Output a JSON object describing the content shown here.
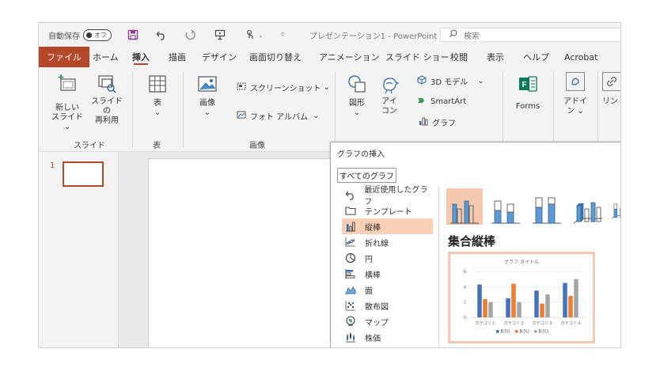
{
  "titlebar": {
    "autosave_label": "自動保存",
    "autosave_state": "オフ",
    "doc_title": "プレゼンテーション1 - PowerPoint",
    "search_placeholder": "検索"
  },
  "tabs": [
    {
      "label": "ファイル"
    },
    {
      "label": "ホーム"
    },
    {
      "label": "挿入"
    },
    {
      "label": "描画"
    },
    {
      "label": "デザイン"
    },
    {
      "label": "画面切り替え"
    },
    {
      "label": "アニメーション"
    },
    {
      "label": "スライド ショー"
    },
    {
      "label": "校閲"
    },
    {
      "label": "表示"
    },
    {
      "label": "ヘルプ"
    },
    {
      "label": "Acrobat"
    }
  ],
  "ribbon": {
    "new_slide_line1": "新しい",
    "new_slide_line2": "スライド",
    "reuse_line1": "スライドの",
    "reuse_line2": "再利用",
    "group_slides": "スライド",
    "table": "表",
    "group_table": "表",
    "images": "画像",
    "screenshot": "スクリーンショット",
    "photo_album": "フォト アルバム",
    "group_images": "画像",
    "shapes": "図形",
    "icons_line1": "アイ",
    "icons_line2": "コン",
    "model3d": "3D モデル",
    "smartart": "SmartArt",
    "chart": "グラフ",
    "forms": "Forms",
    "addins_line1": "アドイ",
    "addins_line2": "ン",
    "link": "リン"
  },
  "slides": [
    {
      "number": "1"
    }
  ],
  "dialog": {
    "title": "グラフの挿入",
    "tab": "すべてのグラフ",
    "types": [
      {
        "label": "最近使用したグラフ",
        "icon": "undo-icon"
      },
      {
        "label": "テンプレート",
        "icon": "folder-icon"
      },
      {
        "label": "縦棒",
        "icon": "column-chart-icon",
        "selected": true
      },
      {
        "label": "折れ線",
        "icon": "line-chart-icon"
      },
      {
        "label": "円",
        "icon": "pie-chart-icon"
      },
      {
        "label": "横棒",
        "icon": "bar-chart-icon"
      },
      {
        "label": "面",
        "icon": "area-chart-icon"
      },
      {
        "label": "散布図",
        "icon": "scatter-chart-icon"
      },
      {
        "label": "マップ",
        "icon": "map-chart-icon"
      },
      {
        "label": "株価",
        "icon": "stock-chart-icon"
      }
    ],
    "selected_subtype": "集合縦棒"
  },
  "chart_data": {
    "type": "bar",
    "title": "グラフ タイトル",
    "categories": [
      "カテゴリ 1",
      "カテゴリ 2",
      "カテゴリ 3",
      "カテゴリ 4"
    ],
    "series": [
      {
        "name": "系列1",
        "values": [
          4.3,
          2.5,
          3.5,
          4.5
        ],
        "color": "#4472c4"
      },
      {
        "name": "系列2",
        "values": [
          2.4,
          4.4,
          1.8,
          2.8
        ],
        "color": "#ed7d31"
      },
      {
        "name": "系列3",
        "values": [
          2.0,
          2.0,
          3.0,
          5.0
        ],
        "color": "#a5a5a5"
      }
    ],
    "yticks": [
      "0",
      "2",
      "4",
      "6"
    ],
    "ylim": [
      0,
      6
    ],
    "legend": "bottom",
    "grid": true
  },
  "colors": {
    "accent": "#b7472a",
    "selection": "#f8cfb7"
  }
}
